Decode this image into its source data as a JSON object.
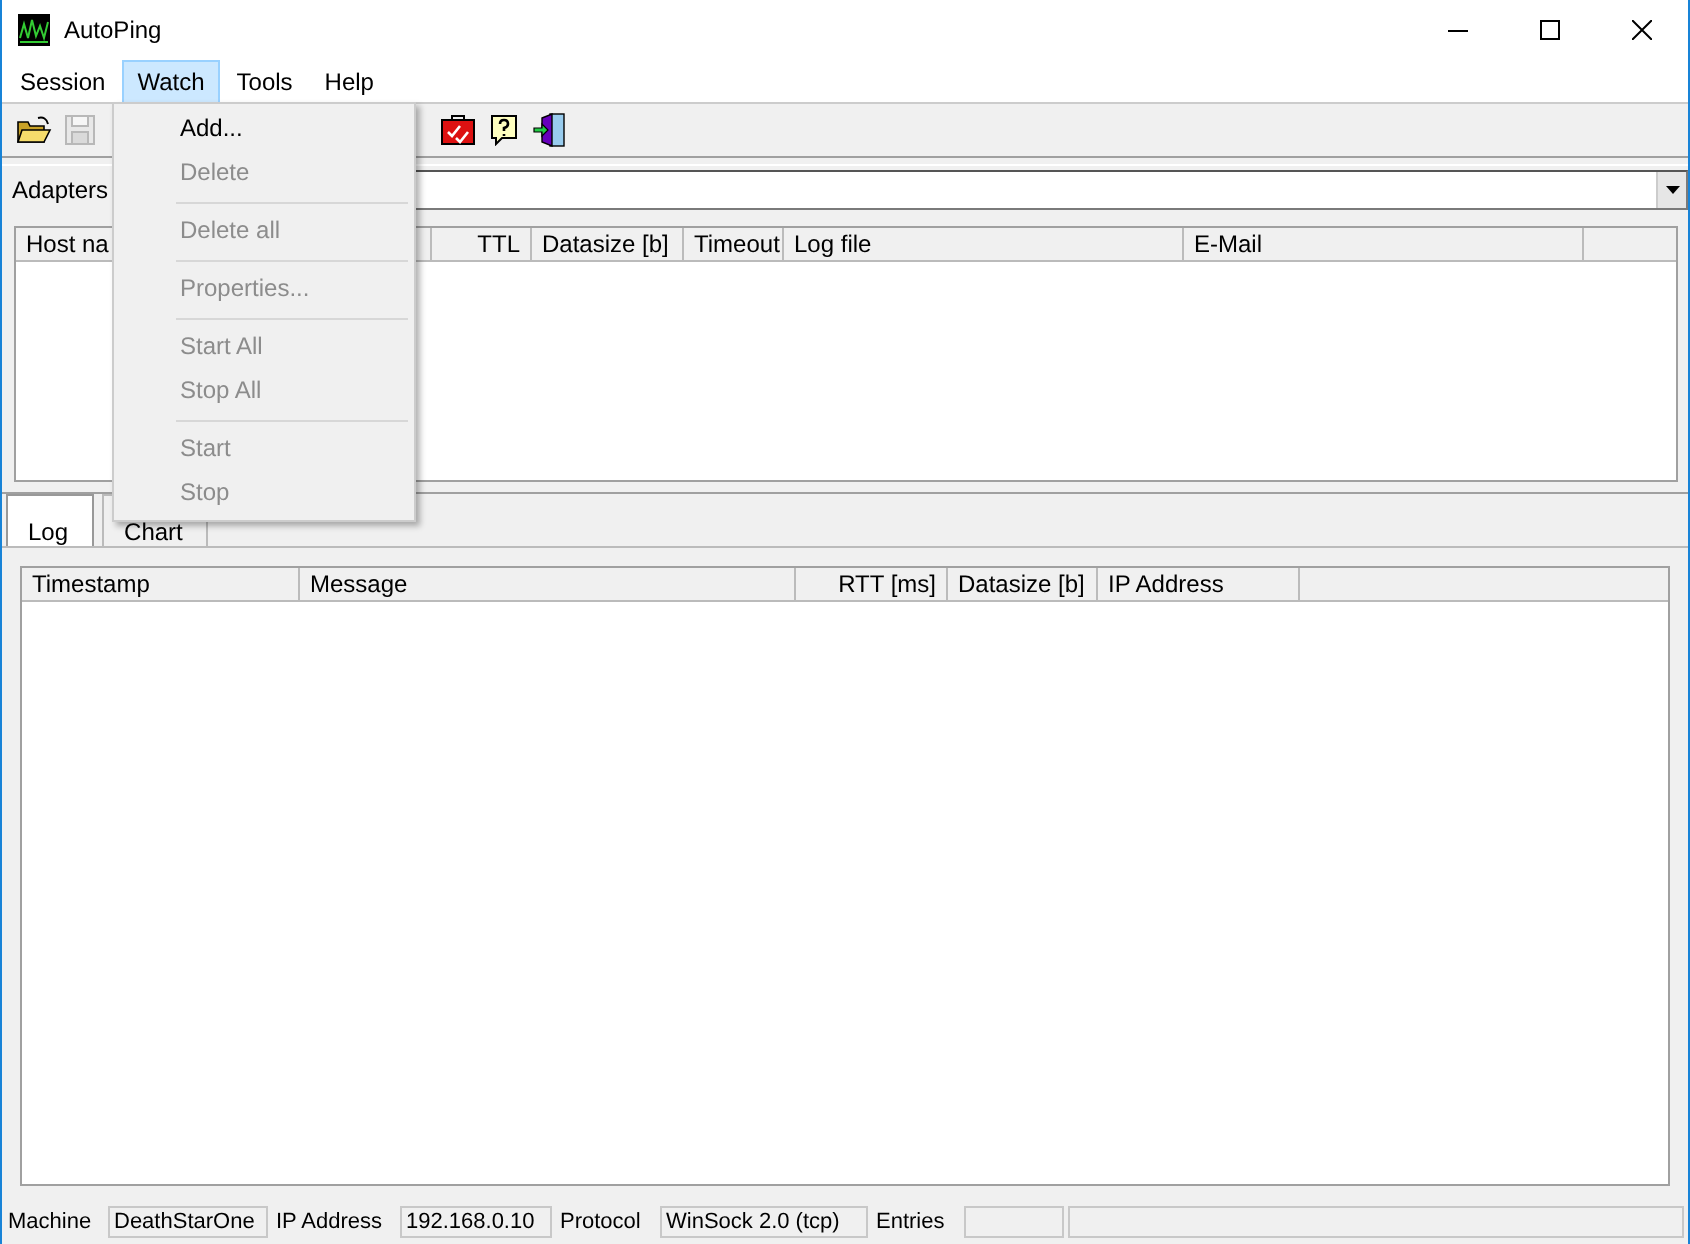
{
  "window": {
    "title": "AutoPing"
  },
  "menu": [
    {
      "label": "Session",
      "selected": false
    },
    {
      "label": "Watch",
      "selected": true
    },
    {
      "label": "Tools",
      "selected": false
    },
    {
      "label": "Help",
      "selected": false
    }
  ],
  "watch_menu": [
    {
      "kind": "item",
      "label": "Add...",
      "disabled": false
    },
    {
      "kind": "item",
      "label": "Delete",
      "disabled": true
    },
    {
      "kind": "separator"
    },
    {
      "kind": "item",
      "label": "Delete all",
      "disabled": true
    },
    {
      "kind": "separator"
    },
    {
      "kind": "item",
      "label": "Properties...",
      "disabled": true
    },
    {
      "kind": "separator"
    },
    {
      "kind": "item",
      "label": "Start All",
      "disabled": true
    },
    {
      "kind": "item",
      "label": "Stop All",
      "disabled": true
    },
    {
      "kind": "separator"
    },
    {
      "kind": "item",
      "label": "Start",
      "disabled": true
    },
    {
      "kind": "item",
      "label": "Stop",
      "disabled": true
    }
  ],
  "toolbar": [
    {
      "kind": "open",
      "disabled": false
    },
    {
      "kind": "save",
      "disabled": true
    },
    {
      "kind": "toolbox",
      "disabled": false
    },
    {
      "kind": "help",
      "disabled": false
    },
    {
      "kind": "exit",
      "disabled": false
    }
  ],
  "adapters": {
    "label": "Adapters"
  },
  "watch_table": {
    "columns": [
      {
        "label": "Host na"
      },
      {
        "label": "TTL"
      },
      {
        "label": "Datasize [b]"
      },
      {
        "label": "Timeout"
      },
      {
        "label": "Log file"
      },
      {
        "label": "E-Mail"
      }
    ]
  },
  "tabs": [
    {
      "label": "Log",
      "selected": true
    },
    {
      "label": "Chart",
      "selected": false
    }
  ],
  "log_table": {
    "columns": [
      {
        "label": "Timestamp"
      },
      {
        "label": "Message"
      },
      {
        "label": "RTT [ms]"
      },
      {
        "label": "Datasize [b]"
      },
      {
        "label": "IP Address"
      }
    ]
  },
  "status_bar": [
    {
      "label": "Machine",
      "value": "DeathStarOne"
    },
    {
      "label": "IP Address",
      "value": "192.168.0.10"
    },
    {
      "label": "Protocol",
      "value": "WinSock 2.0 (tcp)"
    },
    {
      "label": "Entries"
    }
  ]
}
